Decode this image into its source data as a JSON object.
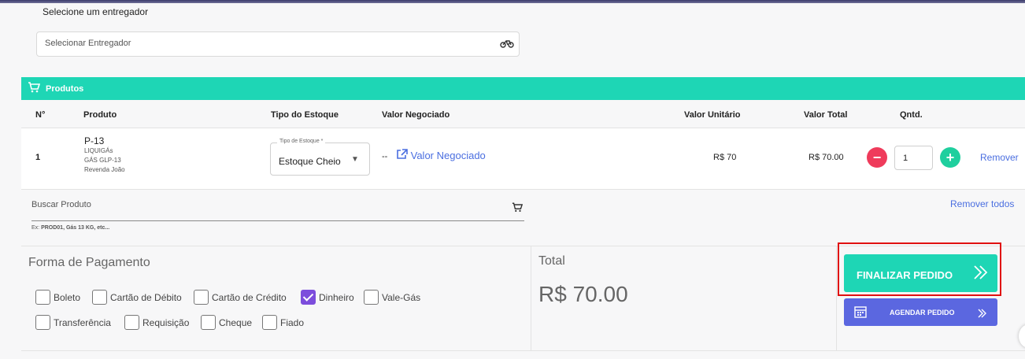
{
  "deliverer": {
    "label": "Selecione um entregador",
    "placeholder": "Selecionar Entregador",
    "icon": "bike-icon"
  },
  "products": {
    "section_title": "Produtos",
    "columns": {
      "num": "N°",
      "product": "Produto",
      "stock_type": "Tipo do Estoque",
      "negotiated": "Valor Negociado",
      "unit": "Valor Unitário",
      "total": "Valor Total",
      "qty": "Qntd."
    },
    "rows": [
      {
        "num": "1",
        "name": "P-13",
        "brand": "LIQUIGÁs",
        "gas": "GÁS GLP-13",
        "reseller": "Revenda João",
        "stock_legend": "Tipo de Estoque *",
        "stock_value": "Estoque Cheio",
        "dash": "--",
        "negotiated_link": "Valor Negociado",
        "unit_price": "R$ 70",
        "total_price": "R$ 70.00",
        "qty": "1",
        "remove": "Remover"
      }
    ],
    "search_placeholder": "Buscar Produto",
    "search_hint_prefix": "Ex: ",
    "search_hint_bold": "PROD01, Gás 13 KG, etc...",
    "remove_all": "Remover todos"
  },
  "payment": {
    "title": "Forma de Pagamento",
    "options": [
      {
        "label": "Boleto",
        "checked": false
      },
      {
        "label": "Cartão de Débito",
        "checked": false
      },
      {
        "label": "Cartão de Crédito",
        "checked": false
      },
      {
        "label": "Dinheiro",
        "checked": true
      },
      {
        "label": "Vale-Gás",
        "checked": false
      },
      {
        "label": "Transferência",
        "checked": false
      },
      {
        "label": "Requisição",
        "checked": false
      },
      {
        "label": "Cheque",
        "checked": false
      },
      {
        "label": "Fiado",
        "checked": false
      }
    ]
  },
  "total": {
    "label": "Total",
    "value": "R$ 70.00"
  },
  "actions": {
    "finalize": "FINALIZAR PEDIDO",
    "schedule": "AGENDAR PEDIDO"
  },
  "colors": {
    "accent": "#1ed6b5",
    "link": "#4a6ee0",
    "minus": "#ef3b5b",
    "plus": "#1fcf9e",
    "schedule": "#5b67e0",
    "checked": "#7c4ddc",
    "highlight": "#e01010"
  }
}
